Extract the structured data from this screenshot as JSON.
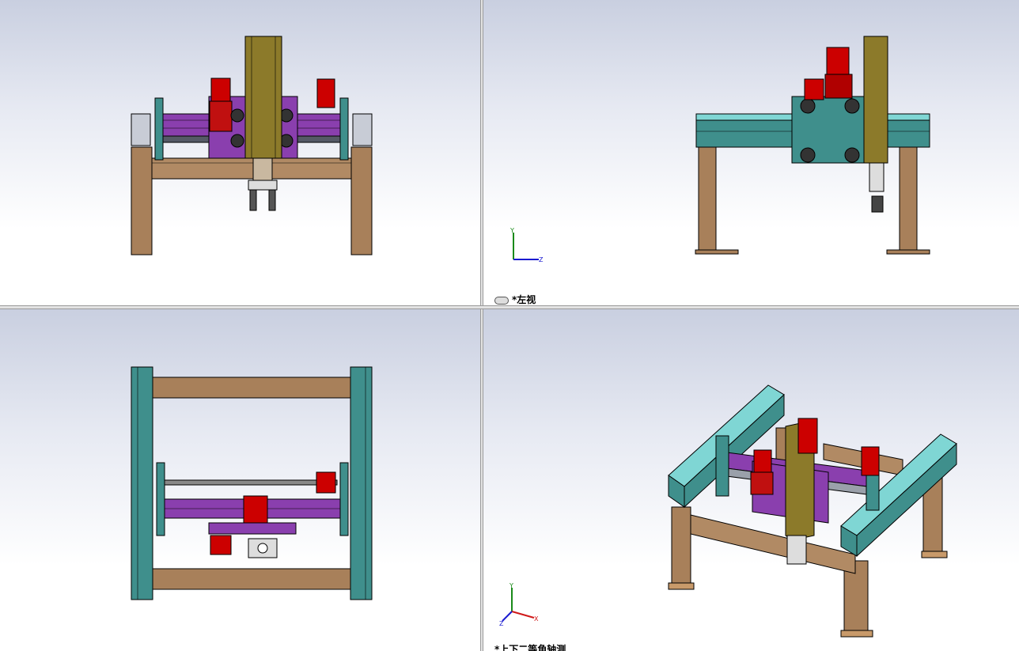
{
  "viewports": {
    "top_left": {
      "label": ""
    },
    "top_right": {
      "label": "*左视",
      "label_icon": "link-icon"
    },
    "bottom_left": {
      "label": ""
    },
    "bottom_right": {
      "label": "*上下二等角轴测"
    }
  },
  "triad": {
    "y": "Y",
    "x": "X",
    "z": "Z"
  },
  "colors": {
    "frame": "#a8805a",
    "rail": "#3f8f8c",
    "rail_light": "#7fd6d4",
    "carriage": "#8a3fae",
    "motor": "#cc0000",
    "column": "#8c7a2a",
    "bg_top": "#c9cfe0"
  }
}
